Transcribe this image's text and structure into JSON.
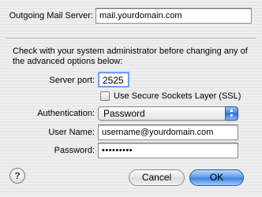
{
  "outgoing_server": {
    "label": "Outgoing Mail Server:",
    "value": "mail.yourdomain.com"
  },
  "advanced": {
    "info_line1": "Check with your system administrator before changing any of",
    "info_line2": "the advanced options below:",
    "server_port_label": "Server port:",
    "server_port_value": "2525",
    "ssl_label": "Use Secure Sockets Layer (SSL)",
    "ssl_checked": false,
    "auth_label": "Authentication:",
    "auth_value": "Password",
    "username_label": "User Name:",
    "username_value": "username@yourdomain.com",
    "password_label": "Password:",
    "password_value": "•••••••••"
  },
  "buttons": {
    "help": "?",
    "cancel": "Cancel",
    "ok": "OK"
  }
}
